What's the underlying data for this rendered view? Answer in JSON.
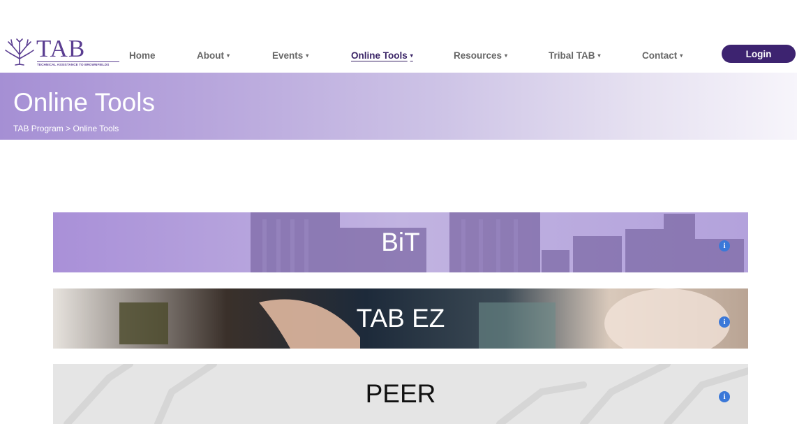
{
  "logo": {
    "word": "TAB",
    "tagline": "TECHNICAL ASSISTANCE TO BROWNFIELDS"
  },
  "nav": {
    "items": [
      {
        "label": "Home",
        "dropdown": false
      },
      {
        "label": "About",
        "dropdown": true
      },
      {
        "label": "Events",
        "dropdown": true
      },
      {
        "label": "Online Tools",
        "dropdown": true,
        "active": true
      },
      {
        "label": "Resources",
        "dropdown": true
      },
      {
        "label": "Tribal TAB",
        "dropdown": true
      },
      {
        "label": "Contact",
        "dropdown": true
      }
    ],
    "caret": "▾",
    "login_label": "Login"
  },
  "hero": {
    "title": "Online Tools",
    "breadcrumb": "TAB Program > Online Tools"
  },
  "tools": [
    {
      "label": "BiT"
    },
    {
      "label": "TAB EZ"
    },
    {
      "label": "PEER"
    }
  ],
  "info_glyph": "i",
  "colors": {
    "brand_purple": "#5a3d91",
    "login_bg": "#3d2370",
    "info_blue": "#3b78d8"
  }
}
